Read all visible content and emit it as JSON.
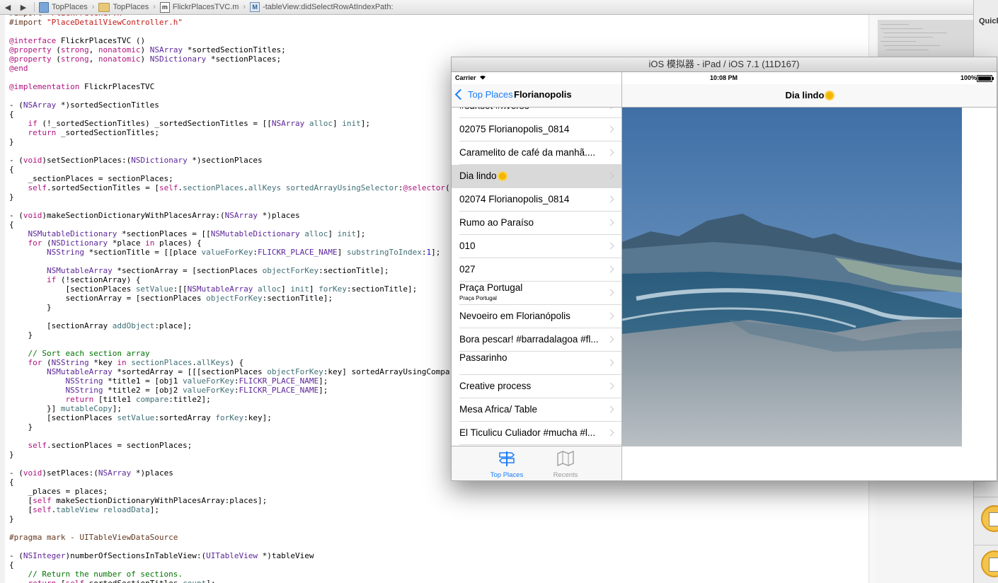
{
  "jumpbar": {
    "back_glyph": "◀",
    "forward_glyph": "▶",
    "crumbs": [
      "TopPlaces",
      "TopPlaces",
      "FlickrPlacesTVC.m",
      "-tableView:didSelectRowAtIndexPath:"
    ],
    "m_label": "m",
    "M_label": "M"
  },
  "code_lines": [
    "#import \"FlickrFetcher.h\"",
    "#import \"PlaceDetailViewController.h\"",
    "",
    "@interface FlickrPlacesTVC ()",
    "@property (strong, nonatomic) NSArray *sortedSectionTitles;",
    "@property (strong, nonatomic) NSDictionary *sectionPlaces;",
    "@end",
    "",
    "@implementation FlickrPlacesTVC",
    "",
    "- (NSArray *)sortedSectionTitles",
    "{",
    "    if (!_sortedSectionTitles) _sortedSectionTitles = [[NSArray alloc] init];",
    "    return _sortedSectionTitles;",
    "}",
    "",
    "- (void)setSectionPlaces:(NSDictionary *)sectionPlaces",
    "{",
    "    _sectionPlaces = sectionPlaces;",
    "    self.sortedSectionTitles = [self.sectionPlaces.allKeys sortedArrayUsingSelector:@selector(",
    "}",
    "",
    "- (void)makeSectionDictionaryWithPlacesArray:(NSArray *)places",
    "{",
    "    NSMutableDictionary *sectionPlaces = [[NSMutableDictionary alloc] init];",
    "    for (NSDictionary *place in places) {",
    "        NSString *sectionTitle = [[place valueForKey:FLICKR_PLACE_NAME] substringToIndex:1];",
    "",
    "        NSMutableArray *sectionArray = [sectionPlaces objectForKey:sectionTitle];",
    "        if (!sectionArray) {",
    "            [sectionPlaces setValue:[[NSMutableArray alloc] init] forKey:sectionTitle];",
    "            sectionArray = [sectionPlaces objectForKey:sectionTitle];",
    "        }",
    "",
    "        [sectionArray addObject:place];",
    "    }",
    "",
    "    // Sort each section array",
    "    for (NSString *key in sectionPlaces.allKeys) {",
    "        NSMutableArray *sortedArray = [[[sectionPlaces objectForKey:key] sortedArrayUsingCompa",
    "            NSString *title1 = [obj1 valueForKey:FLICKR_PLACE_NAME];",
    "            NSString *title2 = [obj2 valueForKey:FLICKR_PLACE_NAME];",
    "            return [title1 compare:title2];",
    "        }] mutableCopy];",
    "        [sectionPlaces setValue:sortedArray forKey:key];",
    "    }",
    "",
    "    self.sectionPlaces = sectionPlaces;",
    "}",
    "",
    "- (void)setPlaces:(NSArray *)places",
    "{",
    "    _places = places;",
    "    [self makeSectionDictionaryWithPlacesArray:places];",
    "    [self.tableView reloadData];",
    "}",
    "",
    "#pragma mark - UITableViewDataSource",
    "",
    "- (NSInteger)numberOfSectionsInTableView:(UITableView *)tableView",
    "{",
    "    // Return the number of sections.",
    "    return [self.sortedSectionTitles count];"
  ],
  "inspector": {
    "quick_label": "Quick"
  },
  "simulator": {
    "title": "iOS 模拟器 - iPad / iOS 7.1 (11D167)",
    "status": {
      "carrier": "Carrier",
      "time": "10:08 PM",
      "battery": "100%"
    },
    "master": {
      "back_label": "Top Places",
      "title": "Florianopolis",
      "rows": [
        {
          "title": "#sunset #riverso"
        },
        {
          "title": "02075 Florianopolis_0814"
        },
        {
          "title": "Caramelito de café da manhã...."
        },
        {
          "title": "Dia lindo",
          "selected": true,
          "sun": true
        },
        {
          "title": "02074 Florianopolis_0814"
        },
        {
          "title": "Rumo ao Paraíso"
        },
        {
          "title": "010"
        },
        {
          "title": "027"
        },
        {
          "title": "Praça Portugal",
          "subtitle": "Praça Portugal"
        },
        {
          "title": "Nevoeiro em Florianópolis"
        },
        {
          "title": "Bora pescar! #barradalagoa #fl..."
        },
        {
          "title": "Passarinho",
          "tall": true
        },
        {
          "title": "Creative process"
        },
        {
          "title": "Mesa Africa/ Table"
        },
        {
          "title": "El Ticulicu Culiador #mucha #l..."
        }
      ],
      "tabs": [
        {
          "label": "Top Places",
          "active": true
        },
        {
          "label": "Recents",
          "active": false
        }
      ]
    },
    "detail": {
      "title": "Dia lindo"
    }
  }
}
